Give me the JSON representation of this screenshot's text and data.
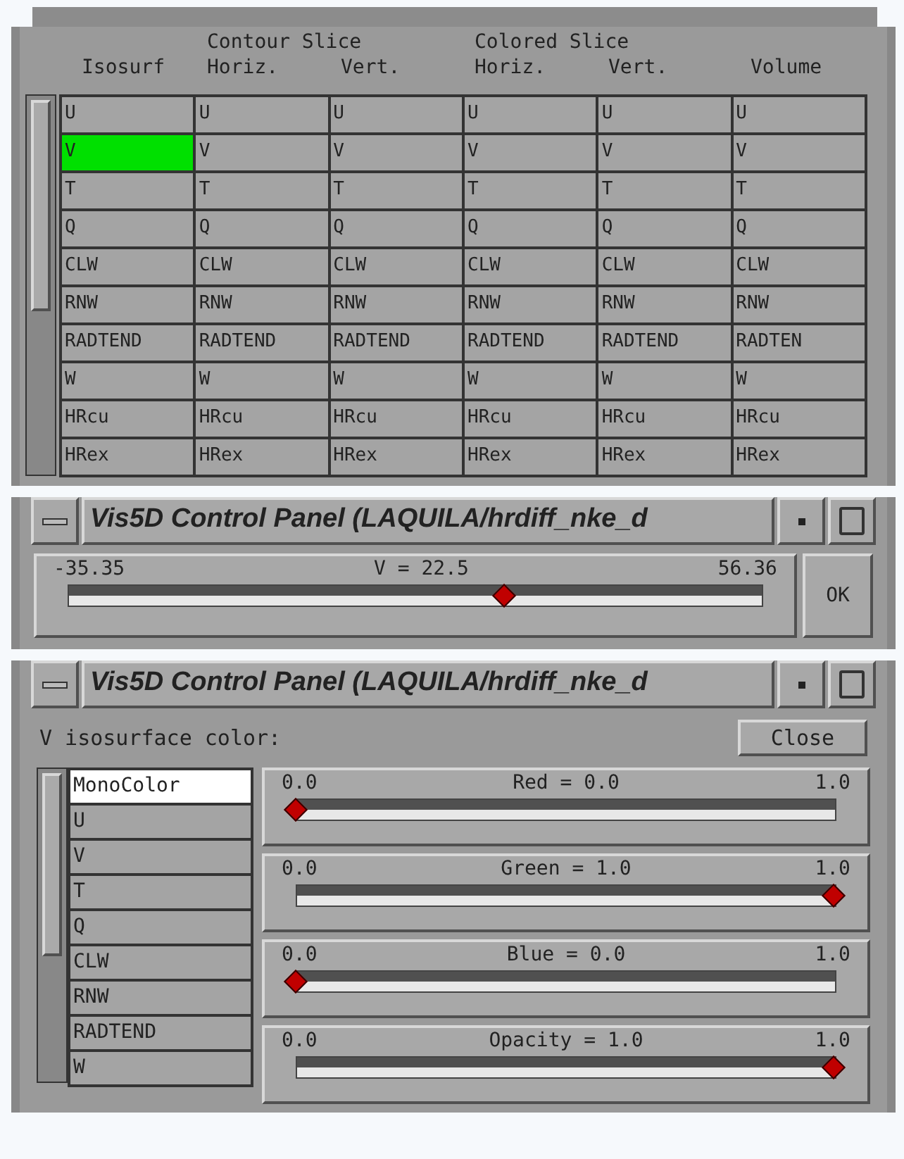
{
  "variable_table": {
    "column_groups": [
      {
        "label": "Isosurf",
        "columns": [
          ""
        ]
      },
      {
        "label": "Contour Slice",
        "columns": [
          "Horiz.",
          "Vert."
        ]
      },
      {
        "label": "Colored Slice",
        "columns": [
          "Horiz.",
          "Vert."
        ]
      },
      {
        "label": "Volume",
        "columns": [
          ""
        ]
      }
    ],
    "rows": [
      {
        "cells": [
          {
            "text": "U",
            "selected": false
          },
          {
            "text": "U",
            "selected": false
          },
          {
            "text": "U",
            "selected": false
          },
          {
            "text": "U",
            "selected": false
          },
          {
            "text": "U",
            "selected": false
          },
          {
            "text": "U",
            "selected": false
          }
        ]
      },
      {
        "cells": [
          {
            "text": "V",
            "selected": true
          },
          {
            "text": "V",
            "selected": false
          },
          {
            "text": "V",
            "selected": false
          },
          {
            "text": "V",
            "selected": false
          },
          {
            "text": "V",
            "selected": false
          },
          {
            "text": "V",
            "selected": false
          }
        ]
      },
      {
        "cells": [
          {
            "text": "T",
            "selected": false
          },
          {
            "text": "T",
            "selected": false
          },
          {
            "text": "T",
            "selected": false
          },
          {
            "text": "T",
            "selected": false
          },
          {
            "text": "T",
            "selected": false
          },
          {
            "text": "T",
            "selected": false
          }
        ]
      },
      {
        "cells": [
          {
            "text": "Q",
            "selected": false
          },
          {
            "text": "Q",
            "selected": false
          },
          {
            "text": "Q",
            "selected": false
          },
          {
            "text": "Q",
            "selected": false
          },
          {
            "text": "Q",
            "selected": false
          },
          {
            "text": "Q",
            "selected": false
          }
        ]
      },
      {
        "cells": [
          {
            "text": "CLW",
            "selected": false
          },
          {
            "text": "CLW",
            "selected": false
          },
          {
            "text": "CLW",
            "selected": false
          },
          {
            "text": "CLW",
            "selected": false
          },
          {
            "text": "CLW",
            "selected": false
          },
          {
            "text": "CLW",
            "selected": false
          }
        ]
      },
      {
        "cells": [
          {
            "text": "RNW",
            "selected": false
          },
          {
            "text": "RNW",
            "selected": false
          },
          {
            "text": "RNW",
            "selected": false
          },
          {
            "text": "RNW",
            "selected": false
          },
          {
            "text": "RNW",
            "selected": false
          },
          {
            "text": "RNW",
            "selected": false
          }
        ]
      },
      {
        "cells": [
          {
            "text": "RADTEND",
            "selected": false
          },
          {
            "text": "RADTEND",
            "selected": false
          },
          {
            "text": "RADTEND",
            "selected": false
          },
          {
            "text": "RADTEND",
            "selected": false
          },
          {
            "text": "RADTEND",
            "selected": false
          },
          {
            "text": "RADTEN",
            "selected": false
          }
        ]
      },
      {
        "cells": [
          {
            "text": "W",
            "selected": false
          },
          {
            "text": "W",
            "selected": false
          },
          {
            "text": "W",
            "selected": false
          },
          {
            "text": "W",
            "selected": false
          },
          {
            "text": "W",
            "selected": false
          },
          {
            "text": "W",
            "selected": false
          }
        ]
      },
      {
        "cells": [
          {
            "text": "HRcu",
            "selected": false
          },
          {
            "text": "HRcu",
            "selected": false
          },
          {
            "text": "HRcu",
            "selected": false
          },
          {
            "text": "HRcu",
            "selected": false
          },
          {
            "text": "HRcu",
            "selected": false
          },
          {
            "text": "HRcu",
            "selected": false
          }
        ]
      },
      {
        "cells": [
          {
            "text": "HRex",
            "selected": false
          },
          {
            "text": "HRex",
            "selected": false
          },
          {
            "text": "HRex",
            "selected": false
          },
          {
            "text": "HRex",
            "selected": false
          },
          {
            "text": "HRex",
            "selected": false
          },
          {
            "text": "HRex",
            "selected": false
          }
        ]
      }
    ]
  },
  "value_window": {
    "title": "Vis5D Control Panel (LAQUILA/hrdiff_nke_d",
    "slider": {
      "min": "-35.35",
      "label": "V = 22.5",
      "max": "56.36",
      "level": 0.63
    },
    "ok_button": "OK"
  },
  "color_window": {
    "title": "Vis5D Control Panel (LAQUILA/hrdiff_nke_d",
    "heading": "V isosurface color:",
    "close_button": "Close",
    "variables": [
      {
        "label": "MonoColor",
        "selected": true
      },
      {
        "label": "U",
        "selected": false
      },
      {
        "label": "V",
        "selected": false
      },
      {
        "label": "T",
        "selected": false
      },
      {
        "label": "Q",
        "selected": false
      },
      {
        "label": "CLW",
        "selected": false
      },
      {
        "label": "RNW",
        "selected": false
      },
      {
        "label": "RADTEND",
        "selected": false
      },
      {
        "label": "W",
        "selected": false
      }
    ],
    "sliders": [
      {
        "min": "0.0",
        "label": "Red = 0.0",
        "max": "1.0",
        "level": 0
      },
      {
        "min": "0.0",
        "label": "Green = 1.0",
        "max": "1.0",
        "level": 1
      },
      {
        "min": "0.0",
        "label": "Blue = 0.0",
        "max": "1.0",
        "level": 0
      },
      {
        "min": "0.0",
        "label": "Opacity = 1.0",
        "max": "1.0",
        "level": 1
      }
    ]
  }
}
